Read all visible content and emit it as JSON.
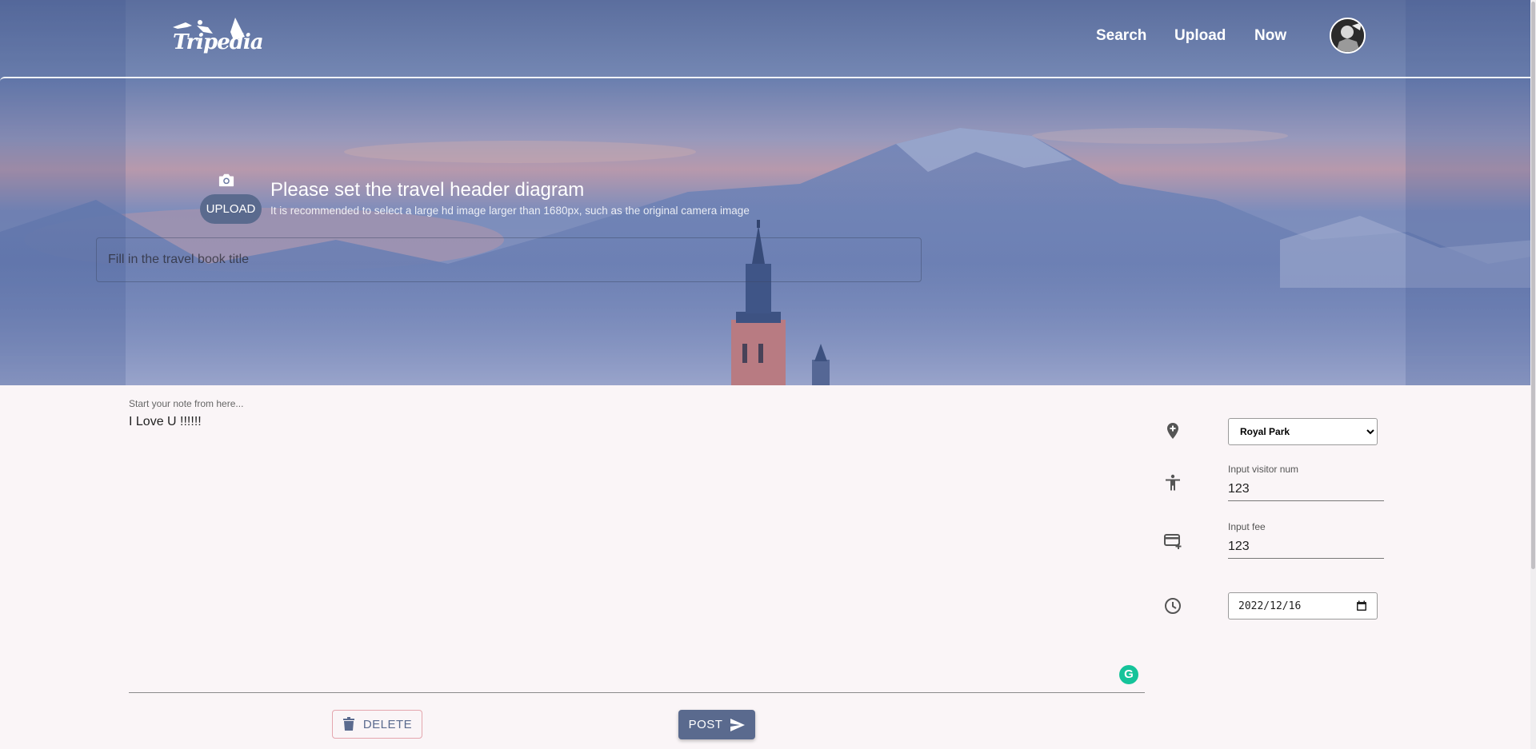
{
  "navbar": {
    "logo_text": "Tripedia",
    "links": {
      "search": "Search",
      "upload": "Upload",
      "now": "Now"
    }
  },
  "hero": {
    "upload_button": "UPLOAD",
    "title": "Please set the travel header diagram",
    "subtitle": "It is recommended to select a large hd image larger than 1680px, such as the original camera image",
    "title_input_placeholder": "Fill in the travel book title"
  },
  "note": {
    "label": "Start your note from here...",
    "content": "I Love U !!!!!!"
  },
  "actions": {
    "delete_label": "DELETE",
    "post_label": "POST"
  },
  "details": {
    "location_selected": "Royal Park",
    "visitor_label": "Input visitor num",
    "visitor_value": "123",
    "fee_label": "Input fee",
    "fee_value": "123",
    "date_value": "2022/12/16"
  },
  "icons": {
    "camera": "camera-icon",
    "location": "add-location-icon",
    "visitor": "accessibility-icon",
    "fee": "add-card-icon",
    "time": "clock-icon",
    "delete": "trash-icon",
    "post": "send-icon",
    "calendar": "calendar-icon",
    "grammarly": "grammarly-icon"
  },
  "colors": {
    "accent": "#5a6a8e",
    "grammarly": "#15c39a",
    "delete_border": "#e4a6ae"
  }
}
